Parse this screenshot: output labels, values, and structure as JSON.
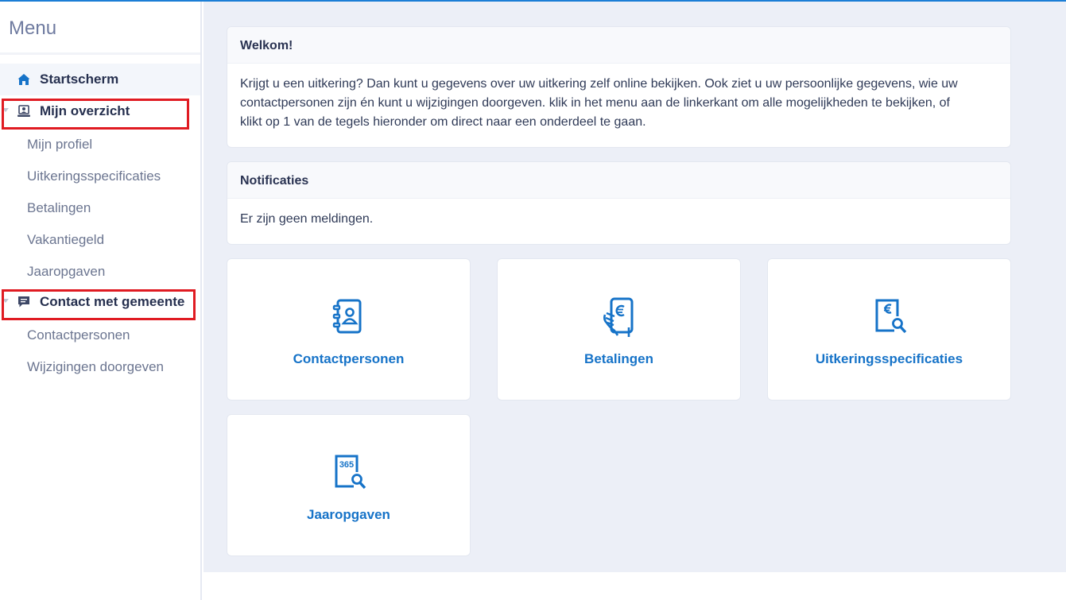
{
  "sidebar": {
    "title": "Menu",
    "items": [
      {
        "label": "Startscherm",
        "icon": "home-icon"
      },
      {
        "label": "Mijn overzicht",
        "icon": "user-card-icon",
        "children": [
          "Mijn profiel",
          "Uitkeringsspecificaties",
          "Betalingen",
          "Vakantiegeld",
          "Jaaropgaven"
        ]
      },
      {
        "label": "Contact met gemeente",
        "icon": "chat-icon",
        "children": [
          "Contactpersonen",
          "Wijzigingen doorgeven"
        ]
      }
    ]
  },
  "welcome": {
    "title": "Welkom!",
    "lines": [
      "Krijgt u een uitkering? Dan kunt u gegevens over uw uitkering zelf online bekijken. Ook ziet u uw persoonlijke gegevens, wie uw",
      "contactpersonen zijn én kunt u wijzigingen doorgeven. klik in het menu aan de linkerkant om alle mogelijkheden te bekijken, of",
      "klikt op 1 van de tegels hieronder om direct naar een onderdeel te gaan."
    ]
  },
  "notifications": {
    "title": "Notificaties",
    "text": "Er zijn geen meldingen."
  },
  "tiles": [
    {
      "label": "Contactpersonen",
      "icon": "contact-book-icon"
    },
    {
      "label": "Betalingen",
      "icon": "phone-euro-icon"
    },
    {
      "label": "Uitkeringsspecificaties",
      "icon": "euro-document-search-icon"
    },
    {
      "label": "Jaaropgaven",
      "icon": "year-365-search-icon",
      "badge": "365"
    }
  ],
  "colors": {
    "accent": "#1673c8",
    "highlight": "#e01b22",
    "background": "#eceff7"
  }
}
